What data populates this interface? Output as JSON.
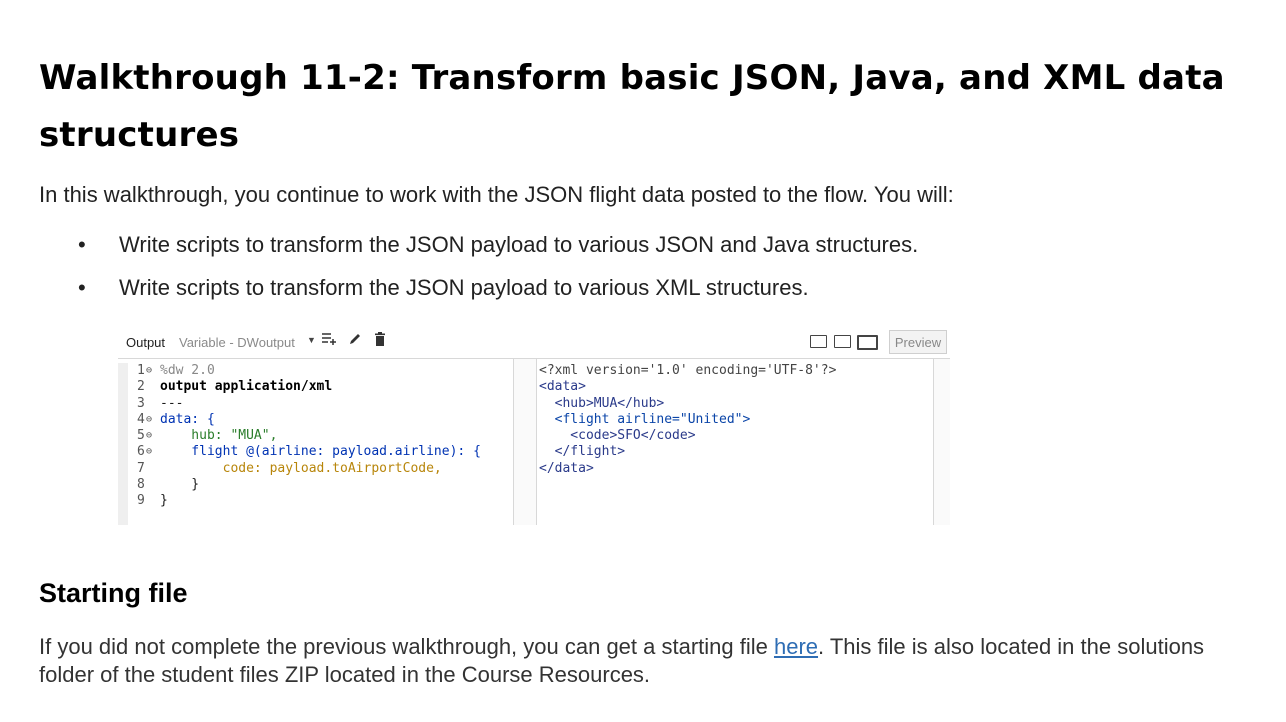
{
  "title": "Walkthrough 11-2: Transform basic JSON, Java, and XML data structures",
  "intro": "In this walkthrough, you continue to work with the JSON flight data posted to the flow. You will:",
  "bullets": [
    "Write scripts to transform the JSON payload to various JSON and Java structures.",
    "Write scripts to transform the JSON payload to various XML structures."
  ],
  "bullet_glyph": "•",
  "editor": {
    "output_label": "Output",
    "variable_label": "Variable - DWoutput",
    "icons": [
      "dropdown-caret-icon",
      "add-list-icon",
      "pencil-icon",
      "trash-icon",
      "layout-split-icon",
      "layout-columns-icon",
      "layout-single-icon"
    ],
    "preview_label": "Preview",
    "line_numbers": [
      "1",
      "2",
      "3",
      "4",
      "5",
      "6",
      "7",
      "8",
      "9"
    ],
    "code_lines": [
      "%dw 2.0",
      "output application/xml",
      "---",
      "data: {",
      "    hub: \"MUA\",",
      "    flight @(airline: payload.airline): {",
      "        code: payload.toAirportCode,",
      "    }",
      "}"
    ],
    "xml_lines": [
      "<?xml version='1.0' encoding='UTF-8'?>",
      "<data>",
      "  <hub>MUA</hub>",
      "  <flight airline=\"United\">",
      "    <code>SFO</code>",
      "  </flight>",
      "</data>"
    ]
  },
  "section_heading": "Starting file",
  "paragraph": {
    "before_link": "If you did not complete the previous walkthrough, you can get a starting file ",
    "link_text": "here",
    "after_link": ". This file is also located in the solutions folder of the student files ZIP located in the Course Resources."
  }
}
